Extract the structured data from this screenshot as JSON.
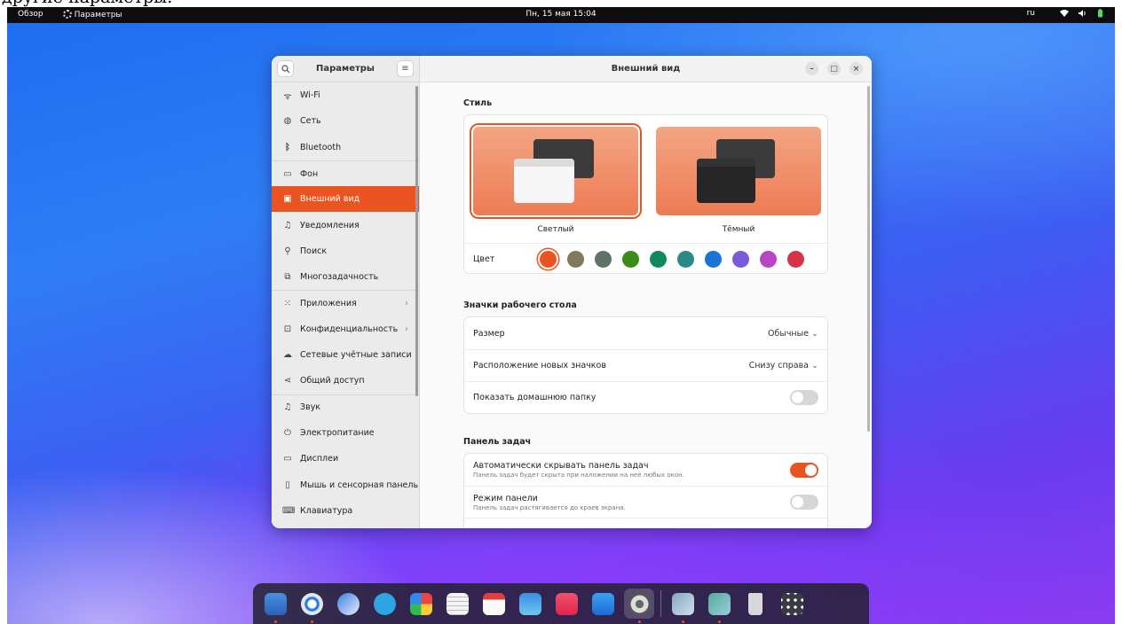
{
  "caption": "другие параметры.",
  "topbar": {
    "overview": "Обзор",
    "app_name": "Параметры",
    "clock": "Пн, 15 мая  15:04",
    "lang": "ru"
  },
  "sidebar": {
    "title": "Параметры",
    "items": [
      {
        "label": "Wi-Fi",
        "icon": "wifi-icon"
      },
      {
        "label": "Сеть",
        "icon": "network-icon"
      },
      {
        "label": "Bluetooth",
        "icon": "bluetooth-icon"
      },
      {
        "label": "Фон",
        "icon": "background-icon"
      },
      {
        "label": "Внешний вид",
        "icon": "appearance-icon"
      },
      {
        "label": "Уведомления",
        "icon": "bell-icon"
      },
      {
        "label": "Поиск",
        "icon": "search-icon"
      },
      {
        "label": "Многозадачность",
        "icon": "multitasking-icon"
      },
      {
        "label": "Приложения",
        "icon": "apps-icon"
      },
      {
        "label": "Конфиденциальность",
        "icon": "lock-icon"
      },
      {
        "label": "Сетевые учётные записи",
        "icon": "cloud-icon"
      },
      {
        "label": "Общий доступ",
        "icon": "share-icon"
      },
      {
        "label": "Звук",
        "icon": "music-note-icon"
      },
      {
        "label": "Электропитание",
        "icon": "power-icon"
      },
      {
        "label": "Дисплеи",
        "icon": "display-icon"
      },
      {
        "label": "Мышь и сенсорная панель",
        "icon": "mouse-icon"
      },
      {
        "label": "Клавиатура",
        "icon": "keyboard-icon"
      }
    ]
  },
  "content": {
    "title": "Внешний вид",
    "style_section": "Стиль",
    "light_label": "Светлый",
    "dark_label": "Тёмный",
    "color_label": "Цвет",
    "accent_colors": [
      "#e95420",
      "#7d7a5e",
      "#5e7267",
      "#3b8a1a",
      "#0e8a5c",
      "#2a8a85",
      "#1a73d6",
      "#7a5ad6",
      "#b844c6",
      "#d6324a"
    ],
    "desktop_icons_section": "Значки рабочего стола",
    "size_label": "Размер",
    "size_value": "Обычные",
    "position_label": "Расположение новых значков",
    "position_value": "Снизу справа",
    "show_home_label": "Показать домашнюю папку",
    "taskbar_section": "Панель задач",
    "autohide_label": "Автоматически скрывать панель задач",
    "autohide_sub": "Панель задач будет скрыта при наложении на неё любых окон.",
    "panel_mode_label": "Режим панели",
    "panel_mode_sub": "Панель задач растягивается до краев экрана."
  },
  "colors": {
    "accent": "#e95420",
    "topbar": "#0d0d10"
  }
}
